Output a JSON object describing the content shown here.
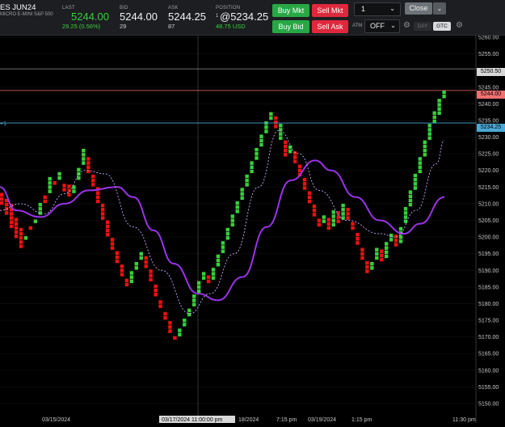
{
  "instrument": {
    "symbol": "ES JUN24",
    "description": "MICRO E-MINI S&P 500"
  },
  "quote": {
    "last_label": "LAST",
    "last_value": "5244.00",
    "last_change": "29.25 (0.56%)",
    "bid_label": "BID",
    "bid_value": "5244.00",
    "bid_size": "29",
    "ask_label": "ASK",
    "ask_value": "5244.25",
    "ask_size": "87",
    "position_label": "POSITION",
    "position_qty": "1",
    "position_value": "@5234.25",
    "position_pnl": "48.75 USD"
  },
  "order_buttons": {
    "buy_mkt": "Buy Mkt",
    "sell_mkt": "Sell Mkt",
    "buy_bid": "Buy Bid",
    "sell_ask": "Sell Ask"
  },
  "quantity": {
    "value": "1"
  },
  "close_button": "Close",
  "atm": {
    "label": "ATM",
    "value": "OFF"
  },
  "tif": {
    "day": "DAY",
    "gtc": "GTC"
  },
  "colors": {
    "up": "#36d13a",
    "down": "#ee1111",
    "slow_ma": "#9a33e6",
    "fast_ma": "#c9a6ff",
    "position_line": "#4aa8d6",
    "last_line": "#f07070"
  },
  "price_axis": {
    "ticks": [
      "5260.00",
      "5255.00",
      "5250.00",
      "5245.00",
      "5240.00",
      "5235.00",
      "5230.00",
      "5225.00",
      "5220.00",
      "5215.00",
      "5210.00",
      "5205.00",
      "5200.00",
      "5195.00",
      "5190.00",
      "5185.00",
      "5180.00",
      "5175.00",
      "5170.00",
      "5165.00",
      "5160.00",
      "5155.00",
      "5150.00"
    ],
    "tag_white": "5250.50",
    "tag_last": "5244.00",
    "tag_position": "5234.25",
    "position_marker": "+1"
  },
  "time_axis": {
    "labels": [
      "03/15/2024",
      "18/2024",
      "7:15 pm",
      "03/19/2024",
      "1:15 pm",
      "11:30 pm"
    ],
    "crosshair_label": "03/17/2024 11:00:00 pm"
  },
  "chart_data": {
    "type": "renko",
    "brick_size": 1.25,
    "ylim": [
      5150,
      5262
    ],
    "levels": {
      "horizontal_line": 5250.5,
      "last": 5244.0,
      "position": 5234.25
    },
    "columns": [
      [
        5213.0,
        5209.5,
        "down"
      ],
      [
        5211.5,
        5206.5,
        "down"
      ],
      [
        5209.0,
        5202.5,
        "down"
      ],
      [
        5205.5,
        5199.5,
        "down"
      ],
      [
        5202.0,
        5196.5,
        "down"
      ],
      [
        5199.0,
        5200.0,
        "up"
      ],
      [
        5202.0,
        5202.5,
        "down"
      ],
      [
        5204.0,
        5205.0,
        "up"
      ],
      [
        5206.5,
        5209.5,
        "up"
      ],
      [
        5211.5,
        5210.0,
        "down"
      ],
      [
        5213.0,
        5217.0,
        "up"
      ],
      [
        5216.5,
        5215.5,
        "down"
      ],
      [
        5217.0,
        5219.5,
        "up"
      ],
      [
        5216.0,
        5213.5,
        "down"
      ],
      [
        5215.5,
        5212.0,
        "down"
      ],
      [
        5213.0,
        5215.5,
        "up"
      ],
      [
        5217.0,
        5220.0,
        "up"
      ],
      [
        5221.5,
        5225.5,
        "up"
      ],
      [
        5224.0,
        5219.0,
        "down"
      ],
      [
        5218.0,
        5215.0,
        "down"
      ],
      [
        5214.0,
        5210.0,
        "down"
      ],
      [
        5209.0,
        5205.0,
        "down"
      ],
      [
        5204.0,
        5200.0,
        "down"
      ],
      [
        5199.0,
        5196.0,
        "down"
      ],
      [
        5195.0,
        5192.0,
        "down"
      ],
      [
        5191.0,
        5188.0,
        "down"
      ],
      [
        5187.0,
        5185.0,
        "down"
      ],
      [
        5186.0,
        5189.0,
        "up"
      ],
      [
        5190.0,
        5192.0,
        "up"
      ],
      [
        5193.0,
        5194.5,
        "up"
      ],
      [
        5193.5,
        5190.5,
        "down"
      ],
      [
        5189.5,
        5186.5,
        "down"
      ],
      [
        5185.5,
        5182.0,
        "down"
      ],
      [
        5181.0,
        5178.5,
        "down"
      ],
      [
        5177.5,
        5175.0,
        "down"
      ],
      [
        5174.0,
        5171.0,
        "down"
      ],
      [
        5170.0,
        5169.0,
        "down"
      ],
      [
        5170.0,
        5172.0,
        "up"
      ],
      [
        5173.0,
        5175.0,
        "up"
      ],
      [
        5176.0,
        5178.0,
        "up"
      ],
      [
        5179.0,
        5182.0,
        "up"
      ],
      [
        5183.0,
        5186.0,
        "up"
      ],
      [
        5187.0,
        5189.5,
        "up"
      ],
      [
        5188.5,
        5186.0,
        "down"
      ],
      [
        5187.0,
        5190.0,
        "up"
      ],
      [
        5191.0,
        5194.0,
        "up"
      ],
      [
        5195.0,
        5198.0,
        "up"
      ],
      [
        5199.0,
        5202.0,
        "up"
      ],
      [
        5203.0,
        5206.0,
        "up"
      ],
      [
        5207.0,
        5210.0,
        "up"
      ],
      [
        5211.0,
        5214.0,
        "up"
      ],
      [
        5215.0,
        5218.0,
        "up"
      ],
      [
        5219.0,
        5222.0,
        "up"
      ],
      [
        5223.0,
        5226.0,
        "up"
      ],
      [
        5227.0,
        5230.0,
        "up"
      ],
      [
        5231.0,
        5234.5,
        "up"
      ],
      [
        5235.0,
        5236.5,
        "up"
      ],
      [
        5235.5,
        5232.5,
        "down"
      ],
      [
        5233.0,
        5229.0,
        "up"
      ],
      [
        5228.0,
        5224.0,
        "down"
      ],
      [
        5225.0,
        5226.5,
        "up"
      ],
      [
        5225.0,
        5222.0,
        "down"
      ],
      [
        5221.0,
        5218.0,
        "down"
      ],
      [
        5217.0,
        5214.0,
        "down"
      ],
      [
        5213.0,
        5210.0,
        "down"
      ],
      [
        5209.0,
        5206.0,
        "down"
      ],
      [
        5205.0,
        5203.0,
        "down"
      ],
      [
        5204.0,
        5206.0,
        "up"
      ],
      [
        5205.0,
        5202.0,
        "down"
      ],
      [
        5203.0,
        5208.0,
        "up"
      ],
      [
        5207.0,
        5204.0,
        "down"
      ],
      [
        5205.0,
        5209.5,
        "up"
      ],
      [
        5208.5,
        5205.0,
        "down"
      ],
      [
        5204.0,
        5202.0,
        "down"
      ],
      [
        5201.0,
        5197.5,
        "down"
      ],
      [
        5196.5,
        5193.0,
        "down"
      ],
      [
        5192.0,
        5189.0,
        "down"
      ],
      [
        5190.0,
        5192.0,
        "up"
      ],
      [
        5193.0,
        5196.5,
        "up"
      ],
      [
        5195.5,
        5192.5,
        "down"
      ],
      [
        5193.5,
        5197.5,
        "up"
      ],
      [
        5198.5,
        5201.0,
        "up"
      ],
      [
        5200.0,
        5197.0,
        "down"
      ],
      [
        5198.0,
        5203.0,
        "up"
      ],
      [
        5204.0,
        5208.0,
        "up"
      ],
      [
        5209.0,
        5213.0,
        "up"
      ],
      [
        5214.0,
        5218.0,
        "up"
      ],
      [
        5219.0,
        5223.0,
        "up"
      ],
      [
        5224.0,
        5228.0,
        "up"
      ],
      [
        5229.0,
        5233.0,
        "up"
      ],
      [
        5234.0,
        5237.5,
        "up"
      ],
      [
        5236.5,
        5240.5,
        "up"
      ],
      [
        5241.5,
        5244.0,
        "up"
      ]
    ],
    "ma_slow": [
      [
        0,
        5215
      ],
      [
        20,
        5208
      ],
      [
        50,
        5206
      ],
      [
        80,
        5210
      ],
      [
        110,
        5214
      ],
      [
        145,
        5215
      ],
      [
        165,
        5212
      ],
      [
        190,
        5202
      ],
      [
        215,
        5192
      ],
      [
        245,
        5183
      ],
      [
        270,
        5181
      ],
      [
        300,
        5188
      ],
      [
        330,
        5203
      ],
      [
        360,
        5217
      ],
      [
        390,
        5223
      ],
      [
        410,
        5220
      ],
      [
        440,
        5212
      ],
      [
        470,
        5205
      ],
      [
        500,
        5201
      ],
      [
        520,
        5204
      ],
      [
        550,
        5212
      ]
    ],
    "ma_fast": [
      [
        0,
        5208
      ],
      [
        25,
        5210
      ],
      [
        55,
        5207
      ],
      [
        80,
        5213
      ],
      [
        105,
        5220
      ],
      [
        130,
        5219
      ],
      [
        165,
        5203
      ],
      [
        200,
        5190
      ],
      [
        235,
        5177
      ],
      [
        260,
        5183
      ],
      [
        290,
        5195
      ],
      [
        320,
        5215
      ],
      [
        345,
        5232
      ],
      [
        370,
        5225
      ],
      [
        395,
        5214
      ],
      [
        430,
        5205
      ],
      [
        470,
        5201
      ],
      [
        490,
        5200
      ],
      [
        515,
        5208
      ],
      [
        540,
        5222
      ],
      [
        550,
        5229
      ]
    ]
  }
}
